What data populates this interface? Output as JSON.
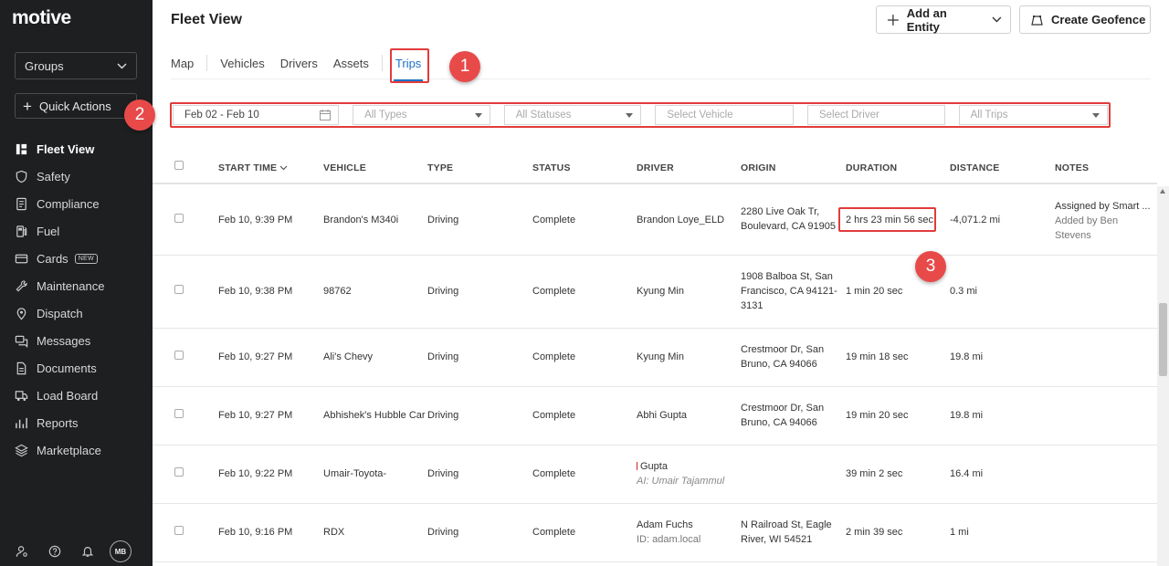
{
  "brand": "motive",
  "sidebar": {
    "groups_label": "Groups",
    "quick_actions_label": "Quick Actions",
    "items": [
      {
        "label": "Fleet View",
        "icon": "fleet-view-icon",
        "active": true
      },
      {
        "label": "Safety",
        "icon": "shield-icon"
      },
      {
        "label": "Compliance",
        "icon": "document-list-icon"
      },
      {
        "label": "Fuel",
        "icon": "fuel-pump-icon"
      },
      {
        "label": "Cards",
        "icon": "card-icon",
        "badge": "NEW"
      },
      {
        "label": "Maintenance",
        "icon": "wrench-icon"
      },
      {
        "label": "Dispatch",
        "icon": "location-pin-icon"
      },
      {
        "label": "Messages",
        "icon": "chat-icon"
      },
      {
        "label": "Documents",
        "icon": "document-icon"
      },
      {
        "label": "Load Board",
        "icon": "truck-icon"
      },
      {
        "label": "Reports",
        "icon": "bar-chart-icon"
      },
      {
        "label": "Marketplace",
        "icon": "layers-icon"
      }
    ],
    "avatar_initials": "MB"
  },
  "header": {
    "title": "Fleet View",
    "add_entity_label": "Add an Entity",
    "create_geofence_label": "Create Geofence"
  },
  "tabs": [
    "Map",
    "Vehicles",
    "Drivers",
    "Assets",
    "Trips"
  ],
  "active_tab": "Trips",
  "filters": {
    "date_range": "Feb 02 - Feb 10",
    "types": "All Types",
    "statuses": "All Statuses",
    "vehicle": "Select Vehicle",
    "driver": "Select Driver",
    "trips": "All Trips"
  },
  "table": {
    "columns": [
      "START TIME",
      "VEHICLE",
      "TYPE",
      "STATUS",
      "DRIVER",
      "ORIGIN",
      "DURATION",
      "DISTANCE",
      "NOTES"
    ],
    "rows": [
      {
        "start": "Feb 10, 9:39 PM",
        "vehicle": "Brandon's M340i",
        "type": "Driving",
        "status": "Complete",
        "driver": "Brandon Loye_ELD",
        "driver_sub": "",
        "origin": [
          "2280 Live Oak Tr,",
          "Boulevard, CA 91905"
        ],
        "duration": "2 hrs 23 min 56 sec",
        "distance": "-4,071.2 mi",
        "notes": [
          "Assigned by Smart ...",
          "Added by Ben",
          "Stevens"
        ]
      },
      {
        "start": "Feb 10, 9:38 PM",
        "vehicle": "98762",
        "type": "Driving",
        "status": "Complete",
        "driver": "Kyung Min",
        "driver_sub": "",
        "origin": [
          "1908 Balboa St, San",
          "Francisco, CA 94121-",
          "3131"
        ],
        "duration": "1 min 20 sec",
        "distance": "0.3 mi",
        "notes": []
      },
      {
        "start": "Feb 10, 9:27 PM",
        "vehicle": "Ali's Chevy",
        "type": "Driving",
        "status": "Complete",
        "driver": "Kyung Min",
        "driver_sub": "",
        "origin": [
          "Crestmoor Dr, San",
          "Bruno, CA 94066"
        ],
        "duration": "19 min 18 sec",
        "distance": "19.8 mi",
        "notes": []
      },
      {
        "start": "Feb 10, 9:27 PM",
        "vehicle": "Abhishek's Hubble Car",
        "type": "Driving",
        "status": "Complete",
        "driver": "Abhi Gupta",
        "driver_sub": "",
        "origin": [
          "Crestmoor Dr, San",
          "Bruno, CA 94066"
        ],
        "duration": "19 min 20 sec",
        "distance": "19.8 mi",
        "notes": []
      },
      {
        "start": "Feb 10, 9:22 PM",
        "vehicle": "Umair-Toyota-",
        "type": "Driving",
        "status": "Complete",
        "driver": "Gupta",
        "driver_sub": "AI: Umair Tajammul",
        "origin": [],
        "duration": "39 min 2 sec",
        "distance": "16.4 mi",
        "notes": []
      },
      {
        "start": "Feb 10, 9:16 PM",
        "vehicle": "RDX",
        "type": "Driving",
        "status": "Complete",
        "driver": "Adam Fuchs",
        "driver_sub": "ID: adam.local",
        "origin": [
          "N Railroad St, Eagle",
          "River, WI 54521"
        ],
        "duration": "2 min 39 sec",
        "distance": "1 mi",
        "notes": []
      }
    ]
  },
  "callouts": [
    "1",
    "2",
    "3"
  ],
  "colors": {
    "sidebar_bg": "#1d1f21",
    "accent": "#1a73c8",
    "annotation": "#e23b3b"
  }
}
